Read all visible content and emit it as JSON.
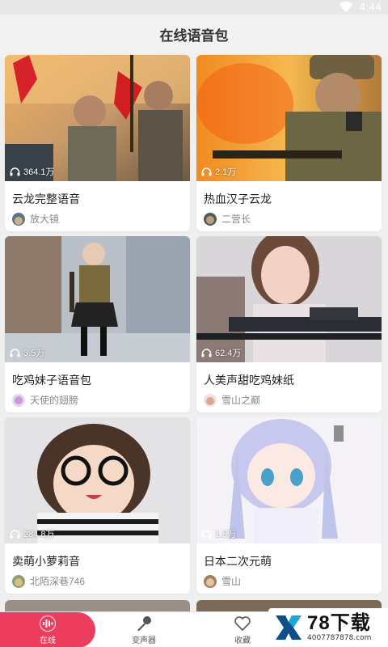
{
  "status_bar": {
    "time": "4:44",
    "icon": "wifi-icon"
  },
  "header": {
    "title": "在线语音包"
  },
  "cards": [
    {
      "title": "云龙完整语音",
      "plays": "364.1万",
      "author": "放大镜"
    },
    {
      "title": "热血汉子云龙",
      "plays": "2.1万",
      "author": "二营长"
    },
    {
      "title": "吃鸡妹子语音包",
      "plays": "3.5万",
      "author": "天使的翅膀"
    },
    {
      "title": "人美声甜吃鸡妹纸",
      "plays": "62.4万",
      "author": "雪山之巅"
    },
    {
      "title": "卖萌小萝莉音",
      "plays": "284.8万",
      "author": "北陌深巷746"
    },
    {
      "title": "日本二次元萌",
      "plays": "1.5万",
      "author": "雪山"
    }
  ],
  "tabs": [
    {
      "label": "在线",
      "icon": "waveform-icon",
      "active": true
    },
    {
      "label": "变声器",
      "icon": "microphone-icon",
      "active": false
    },
    {
      "label": "收藏",
      "icon": "heart-icon",
      "active": false
    }
  ],
  "watermark": {
    "brand": "78下载",
    "url": "4007787878.com"
  },
  "colors": {
    "accent": "#ec3d5e",
    "background": "#efefef"
  }
}
